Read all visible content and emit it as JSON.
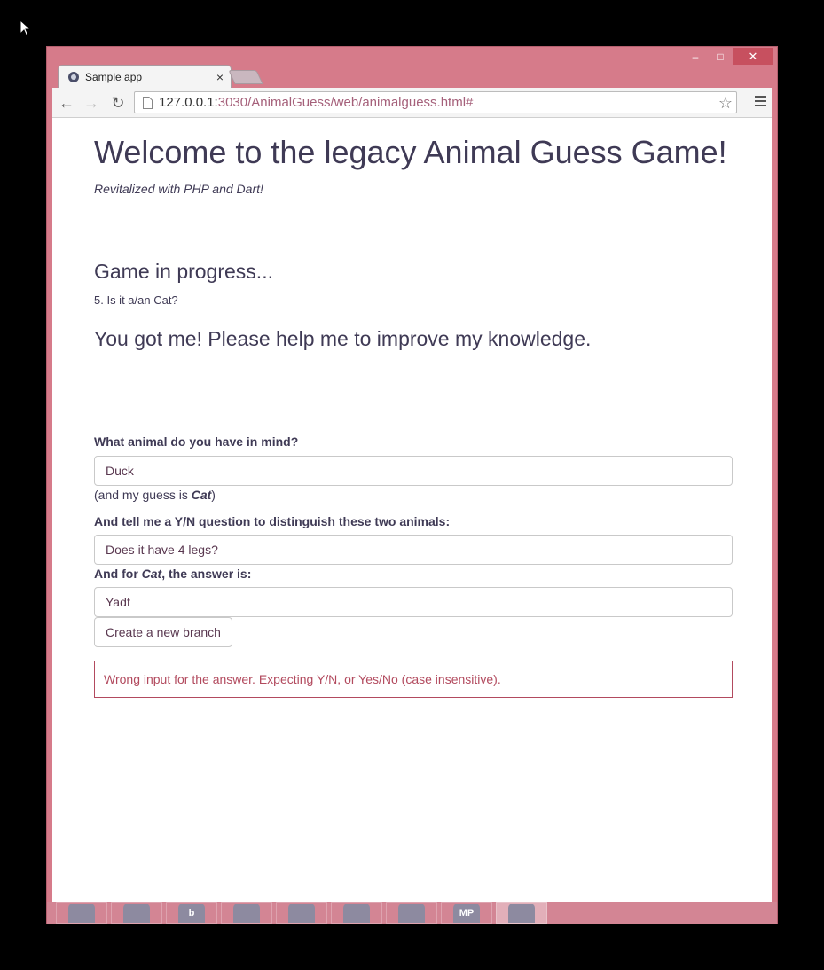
{
  "browser": {
    "tab_title": "Sample app",
    "tab_close": "×",
    "url_host": "127.0.0.1:",
    "url_rest": "3030/AnimalGuess/web/animalguess.html#",
    "window_controls": {
      "minimize": "–",
      "maximize": "□",
      "close": "✕"
    },
    "icons": [
      "back-arrow-icon",
      "forward-arrow-icon",
      "reload-icon",
      "page-icon",
      "star-icon",
      "menu-icon"
    ]
  },
  "page": {
    "title": "Welcome to the legacy Animal Guess Game!",
    "subtitle": "Revitalized with PHP and Dart!",
    "status": "Game in progress...",
    "question": "5. Is it a/an Cat?",
    "got_me": "You got me! Please help me to improve my knowledge.",
    "animal_label": "What animal do you have in mind?",
    "animal_value": "Duck",
    "guess_prefix": "(and my guess is ",
    "guess_animal": "Cat",
    "guess_suffix": ")",
    "question_label": "And tell me a Y/N question to distinguish these two animals:",
    "question_value": "Does it have 4 legs?",
    "answer_label_prefix": "And for ",
    "answer_label_animal": "Cat",
    "answer_label_suffix": ", the answer is:",
    "answer_value": "Yadf",
    "create_button": "Create a new branch",
    "error_message": "Wrong input for the answer. Expecting Y/N, or Yes/No (case insensitive)."
  },
  "taskbar": {
    "items": [
      {
        "name": "app-icon-1",
        "label": ""
      },
      {
        "name": "app-icon-2",
        "label": ""
      },
      {
        "name": "app-icon-3",
        "label": "b"
      },
      {
        "name": "app-icon-4",
        "label": ""
      },
      {
        "name": "app-icon-5",
        "label": ""
      },
      {
        "name": "app-icon-6",
        "label": ""
      },
      {
        "name": "app-icon-7",
        "label": ""
      },
      {
        "name": "app-icon-8",
        "label": "MP"
      },
      {
        "name": "app-icon-9",
        "label": ""
      }
    ]
  },
  "colors": {
    "window_frame": "#d67b8a",
    "text": "#3f3a55",
    "error": "#b24a5e",
    "close_button": "#c7505f"
  }
}
